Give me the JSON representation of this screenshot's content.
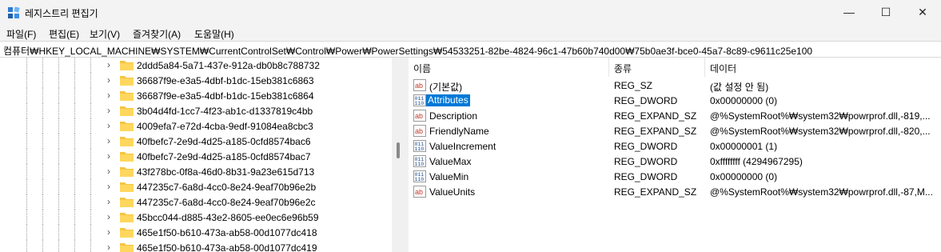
{
  "window": {
    "title": "레지스트리 편집기",
    "minimize_glyph": "—",
    "maximize_glyph": "☐",
    "close_glyph": "✕"
  },
  "menu": [
    "파일(F)",
    "편집(E)",
    "보기(V)",
    "즐겨찾기(A)",
    "도움말(H)"
  ],
  "address_bar": "컴퓨터₩HKEY_LOCAL_MACHINE₩SYSTEM₩CurrentControlSet₩Control₩Power₩PowerSettings₩54533251-82be-4824-96c1-47b60b740d00₩75b0ae3f-bce0-45a7-8c89-c9611c25e100",
  "tree": {
    "items": [
      "2ddd5a84-5a71-437e-912a-db0b8c788732",
      "36687f9e-e3a5-4dbf-b1dc-15eb381c6863",
      "36687f9e-e3a5-4dbf-b1dc-15eb381c6864",
      "3b04d4fd-1cc7-4f23-ab1c-d1337819c4bb",
      "4009efa7-e72d-4cba-9edf-91084ea8cbc3",
      "40fbefc7-2e9d-4d25-a185-0cfd8574bac6",
      "40fbefc7-2e9d-4d25-a185-0cfd8574bac7",
      "43f278bc-0f8a-46d0-8b31-9a23e615d713",
      "447235c7-6a8d-4cc0-8e24-9eaf70b96e2b",
      "447235c7-6a8d-4cc0-8e24-9eaf70b96e2c",
      "45bcc044-d885-43e2-8605-ee0ec6e96b59",
      "465e1f50-b610-473a-ab58-00d1077dc418",
      "465e1f50-b610-473a-ab58-00d1077dc419"
    ],
    "expander_glyph": "›"
  },
  "list": {
    "columns": [
      "이름",
      "종류",
      "데이터"
    ],
    "rows": [
      {
        "icon": "string-value-icon",
        "name": "(기본값)",
        "type": "REG_SZ",
        "data": "(값 설정 안 됨)"
      },
      {
        "icon": "binary-value-icon",
        "name": "Attributes",
        "type": "REG_DWORD",
        "data": "0x00000000 (0)",
        "selected": true
      },
      {
        "icon": "string-value-icon",
        "name": "Description",
        "type": "REG_EXPAND_SZ",
        "data": "@%SystemRoot%₩system32₩powrprof.dll,-819,..."
      },
      {
        "icon": "string-value-icon",
        "name": "FriendlyName",
        "type": "REG_EXPAND_SZ",
        "data": "@%SystemRoot%₩system32₩powrprof.dll,-820,..."
      },
      {
        "icon": "binary-value-icon",
        "name": "ValueIncrement",
        "type": "REG_DWORD",
        "data": "0x00000001 (1)"
      },
      {
        "icon": "binary-value-icon",
        "name": "ValueMax",
        "type": "REG_DWORD",
        "data": "0xffffffff (4294967295)"
      },
      {
        "icon": "binary-value-icon",
        "name": "ValueMin",
        "type": "REG_DWORD",
        "data": "0x00000000 (0)"
      },
      {
        "icon": "string-value-icon",
        "name": "ValueUnits",
        "type": "REG_EXPAND_SZ",
        "data": "@%SystemRoot%₩system32₩powrprof.dll,-87,M..."
      }
    ]
  },
  "colors": {
    "selection": "#0078d7",
    "folder": "#f4c542",
    "string_icon_text": "#c0392b",
    "binary_icon": "#1f4e8c"
  }
}
